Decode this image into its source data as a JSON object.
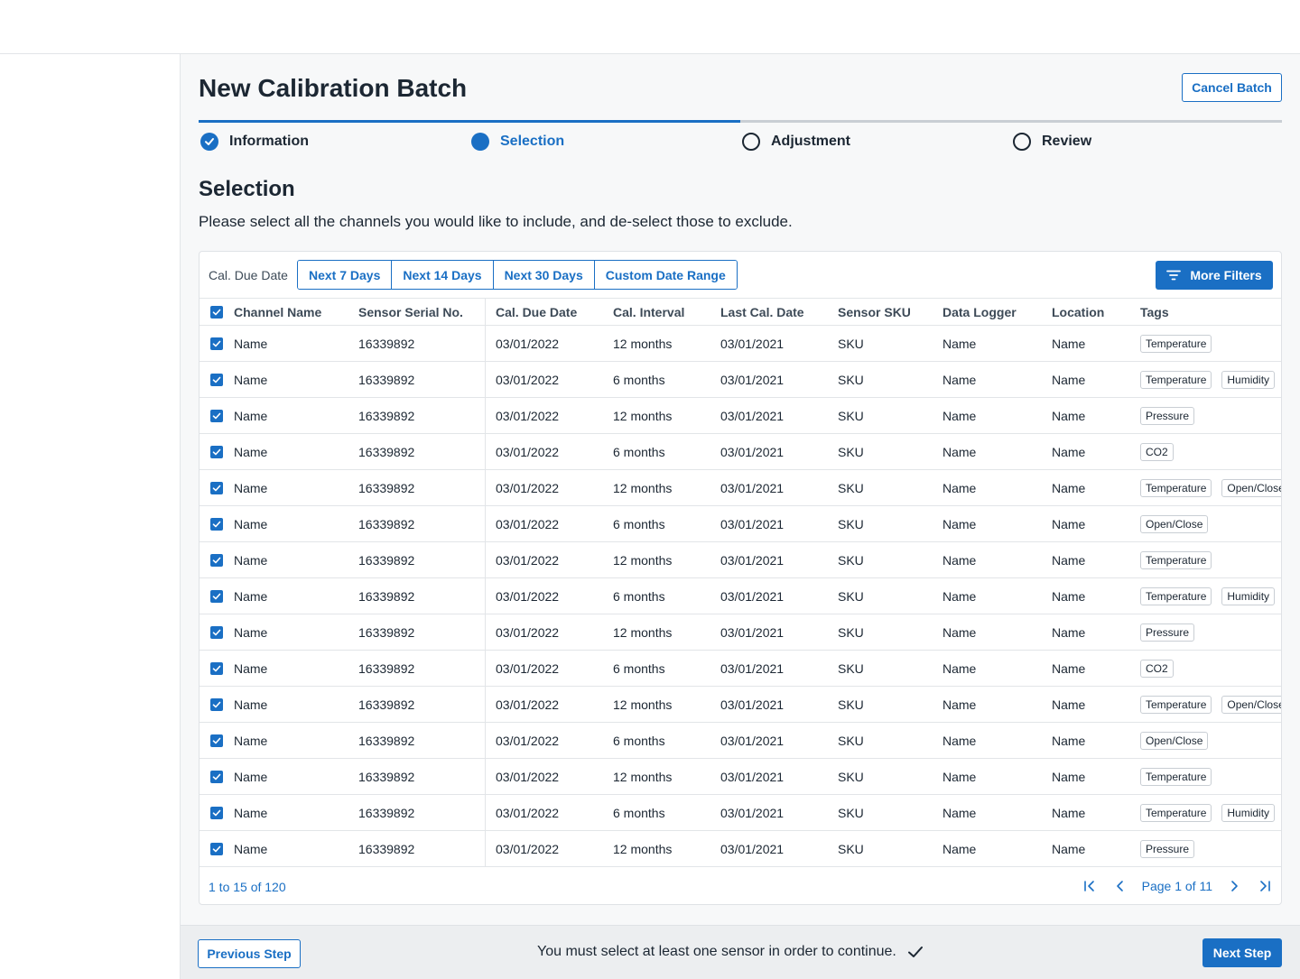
{
  "page": {
    "title": "New Calibration Batch",
    "cancel_label": "Cancel Batch"
  },
  "steps": [
    {
      "label": "Information",
      "state": "done"
    },
    {
      "label": "Selection",
      "state": "current"
    },
    {
      "label": "Adjustment",
      "state": "todo"
    },
    {
      "label": "Review",
      "state": "todo"
    }
  ],
  "section": {
    "title": "Selection",
    "description": "Please select all the channels you would like to include, and de-select those to exclude."
  },
  "filters": {
    "label": "Cal. Due Date",
    "options": [
      "Next 7 Days",
      "Next 14 Days",
      "Next 30 Days",
      "Custom Date Range"
    ],
    "more_label": "More Filters"
  },
  "table": {
    "columns": [
      "Channel Name",
      "Sensor Serial No.",
      "Cal. Due Date",
      "Cal. Interval",
      "Last Cal. Date",
      "Sensor SKU",
      "Data Logger",
      "Location",
      "Tags"
    ],
    "rows": [
      {
        "name": "Name",
        "serial": "16339892",
        "due": "03/01/2022",
        "interval": "12 months",
        "last": "03/01/2021",
        "sku": "SKU",
        "logger": "Name",
        "location": "Name",
        "tags": [
          "Temperature"
        ]
      },
      {
        "name": "Name",
        "serial": "16339892",
        "due": "03/01/2022",
        "interval": "6 months",
        "last": "03/01/2021",
        "sku": "SKU",
        "logger": "Name",
        "location": "Name",
        "tags": [
          "Temperature",
          "Humidity"
        ]
      },
      {
        "name": "Name",
        "serial": "16339892",
        "due": "03/01/2022",
        "interval": "12 months",
        "last": "03/01/2021",
        "sku": "SKU",
        "logger": "Name",
        "location": "Name",
        "tags": [
          "Pressure"
        ]
      },
      {
        "name": "Name",
        "serial": "16339892",
        "due": "03/01/2022",
        "interval": "6 months",
        "last": "03/01/2021",
        "sku": "SKU",
        "logger": "Name",
        "location": "Name",
        "tags": [
          "CO2"
        ]
      },
      {
        "name": "Name",
        "serial": "16339892",
        "due": "03/01/2022",
        "interval": "12 months",
        "last": "03/01/2021",
        "sku": "SKU",
        "logger": "Name",
        "location": "Name",
        "tags": [
          "Temperature",
          "Open/Close"
        ]
      },
      {
        "name": "Name",
        "serial": "16339892",
        "due": "03/01/2022",
        "interval": "6 months",
        "last": "03/01/2021",
        "sku": "SKU",
        "logger": "Name",
        "location": "Name",
        "tags": [
          "Open/Close"
        ]
      },
      {
        "name": "Name",
        "serial": "16339892",
        "due": "03/01/2022",
        "interval": "12 months",
        "last": "03/01/2021",
        "sku": "SKU",
        "logger": "Name",
        "location": "Name",
        "tags": [
          "Temperature"
        ]
      },
      {
        "name": "Name",
        "serial": "16339892",
        "due": "03/01/2022",
        "interval": "6 months",
        "last": "03/01/2021",
        "sku": "SKU",
        "logger": "Name",
        "location": "Name",
        "tags": [
          "Temperature",
          "Humidity"
        ]
      },
      {
        "name": "Name",
        "serial": "16339892",
        "due": "03/01/2022",
        "interval": "12 months",
        "last": "03/01/2021",
        "sku": "SKU",
        "logger": "Name",
        "location": "Name",
        "tags": [
          "Pressure"
        ]
      },
      {
        "name": "Name",
        "serial": "16339892",
        "due": "03/01/2022",
        "interval": "6 months",
        "last": "03/01/2021",
        "sku": "SKU",
        "logger": "Name",
        "location": "Name",
        "tags": [
          "CO2"
        ]
      },
      {
        "name": "Name",
        "serial": "16339892",
        "due": "03/01/2022",
        "interval": "12 months",
        "last": "03/01/2021",
        "sku": "SKU",
        "logger": "Name",
        "location": "Name",
        "tags": [
          "Temperature",
          "Open/Close"
        ]
      },
      {
        "name": "Name",
        "serial": "16339892",
        "due": "03/01/2022",
        "interval": "6 months",
        "last": "03/01/2021",
        "sku": "SKU",
        "logger": "Name",
        "location": "Name",
        "tags": [
          "Open/Close"
        ]
      },
      {
        "name": "Name",
        "serial": "16339892",
        "due": "03/01/2022",
        "interval": "12 months",
        "last": "03/01/2021",
        "sku": "SKU",
        "logger": "Name",
        "location": "Name",
        "tags": [
          "Temperature"
        ]
      },
      {
        "name": "Name",
        "serial": "16339892",
        "due": "03/01/2022",
        "interval": "6 months",
        "last": "03/01/2021",
        "sku": "SKU",
        "logger": "Name",
        "location": "Name",
        "tags": [
          "Temperature",
          "Humidity"
        ]
      },
      {
        "name": "Name",
        "serial": "16339892",
        "due": "03/01/2022",
        "interval": "12 months",
        "last": "03/01/2021",
        "sku": "SKU",
        "logger": "Name",
        "location": "Name",
        "tags": [
          "Pressure"
        ]
      }
    ]
  },
  "pagination": {
    "range": "1 to 15 of 120",
    "page_label": "Page 1 of 11"
  },
  "footer": {
    "prev_label": "Previous Step",
    "message": "You must select at least one sensor in order to continue.",
    "next_label": "Next Step"
  },
  "colors": {
    "accent": "#1a6fc4",
    "text": "#1c2733",
    "border": "#e2e5e8",
    "background": "#f7f8f9"
  },
  "icons": {
    "step_done": "check-circle-icon",
    "checkbox": "checkbox-checked-icon",
    "filter": "filter-lines-icon",
    "first": "first-page-icon",
    "prev": "chevron-left-icon",
    "next": "chevron-right-icon",
    "last": "last-page-icon",
    "message": "checkmark-icon"
  }
}
